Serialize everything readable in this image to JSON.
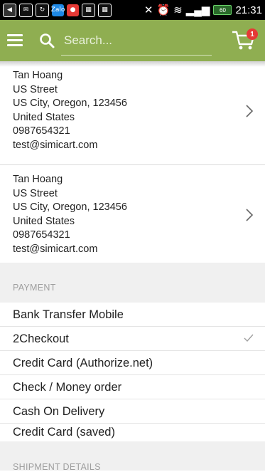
{
  "status_bar": {
    "time": "21:31",
    "battery": "60",
    "zalo": "Zalo"
  },
  "search": {
    "placeholder": "Search..."
  },
  "cart": {
    "badge_count": "1"
  },
  "addresses": [
    {
      "name": "Tan Hoang",
      "street": "US Street",
      "city_line": "US City, Oregon, 123456",
      "country": "United States",
      "phone": "0987654321",
      "email": "test@simicart.com"
    },
    {
      "name": "Tan Hoang",
      "street": "US Street",
      "city_line": "US City, Oregon, 123456",
      "country": "United States",
      "phone": "0987654321",
      "email": "test@simicart.com"
    }
  ],
  "payment": {
    "header": "PAYMENT",
    "methods": [
      {
        "label": "Bank Transfer Mobile",
        "selected": false
      },
      {
        "label": "2Checkout",
        "selected": true
      },
      {
        "label": "Credit Card (Authorize.net)",
        "selected": false
      },
      {
        "label": "Check / Money order",
        "selected": false
      },
      {
        "label": "Cash On Delivery",
        "selected": false
      },
      {
        "label": "Credit Card (saved)",
        "selected": false
      }
    ]
  },
  "shipment": {
    "header": "SHIPMENT DETAILS"
  },
  "colors": {
    "toolbar": "#8fae51",
    "badge": "#e53935",
    "section_bg": "#f0f0f0"
  }
}
